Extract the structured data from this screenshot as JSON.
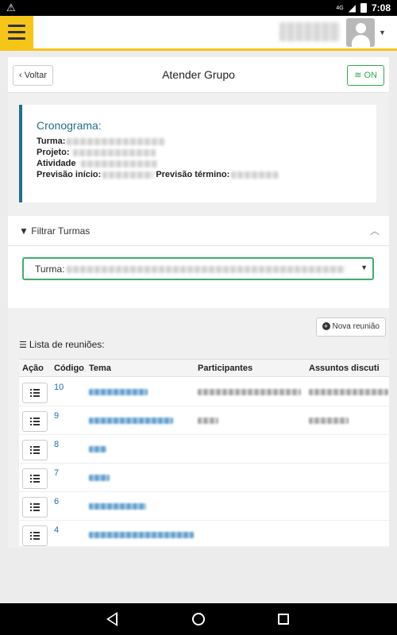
{
  "status_bar": {
    "network": "4G",
    "time": "7:08"
  },
  "header": {
    "back_label": "Voltar",
    "title": "Atender Grupo",
    "status_label": "ON"
  },
  "cronograma": {
    "title": "Cronograma:",
    "turma_label": "Turma:",
    "projeto_label": "Projeto:",
    "atividade_label": "Atividade",
    "previsao_inicio_label": "Previsão início:",
    "previsao_termino_label": "Previsão término:"
  },
  "filter": {
    "title": "Filtrar Turmas",
    "select_label": "Turma:"
  },
  "list": {
    "new_button": "Nova reunião",
    "title": "Lista de reuniões:",
    "columns": [
      "Ação",
      "Código",
      "Tema",
      "Participantes",
      "Assuntos discuti"
    ],
    "rows": [
      {
        "code": "10"
      },
      {
        "code": "9"
      },
      {
        "code": "8"
      },
      {
        "code": "7"
      },
      {
        "code": "6"
      },
      {
        "code": "4"
      }
    ]
  },
  "colors": {
    "accent_yellow": "#f5c518",
    "primary_teal": "#1f6f8f",
    "success_green": "#2eaa4f",
    "link_blue": "#1a6fb0"
  }
}
